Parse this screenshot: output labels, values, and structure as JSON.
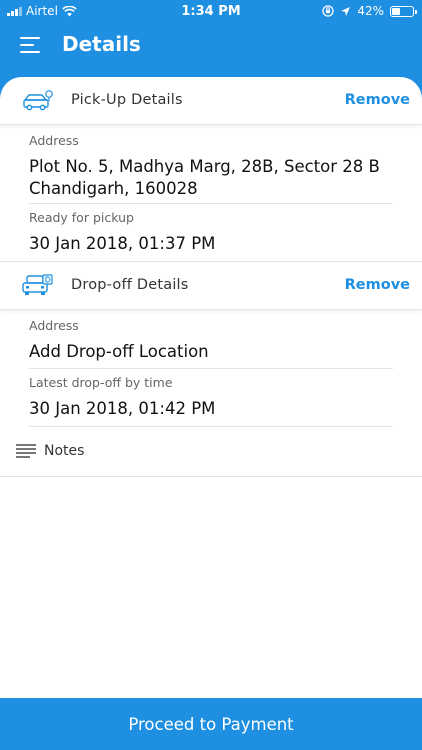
{
  "status_bar": {
    "carrier": "Airtel",
    "time": "1:34 PM",
    "battery_percent": "42%",
    "battery_level": 0.42
  },
  "header": {
    "title": "Details",
    "menu_icon": "hamburger-icon"
  },
  "pickup": {
    "title": "Pick-Up Details",
    "remove_label": "Remove",
    "icon": "pickup-car-icon",
    "address_label": "Address",
    "address_line1": "Plot No. 5, Madhya Marg, 28B, Sector 28 B",
    "address_line2": "Chandigarh, 160028",
    "time_label": "Ready for pickup",
    "time_value": "30 Jan 2018, 01:37 PM"
  },
  "dropoff": {
    "title": "Drop-off Details",
    "remove_label": "Remove",
    "icon": "dropoff-car-icon",
    "address_label": "Address",
    "address_value": "Add Drop-off Location",
    "time_label": "Latest drop-off by time",
    "time_value": "30 Jan 2018, 01:42 PM"
  },
  "notes": {
    "label": "Notes",
    "icon": "notes-icon"
  },
  "footer": {
    "proceed_label": "Proceed to Payment"
  },
  "colors": {
    "primary": "#1e8fe1",
    "background": "#ffffff",
    "divider": "#e4e4e4"
  }
}
